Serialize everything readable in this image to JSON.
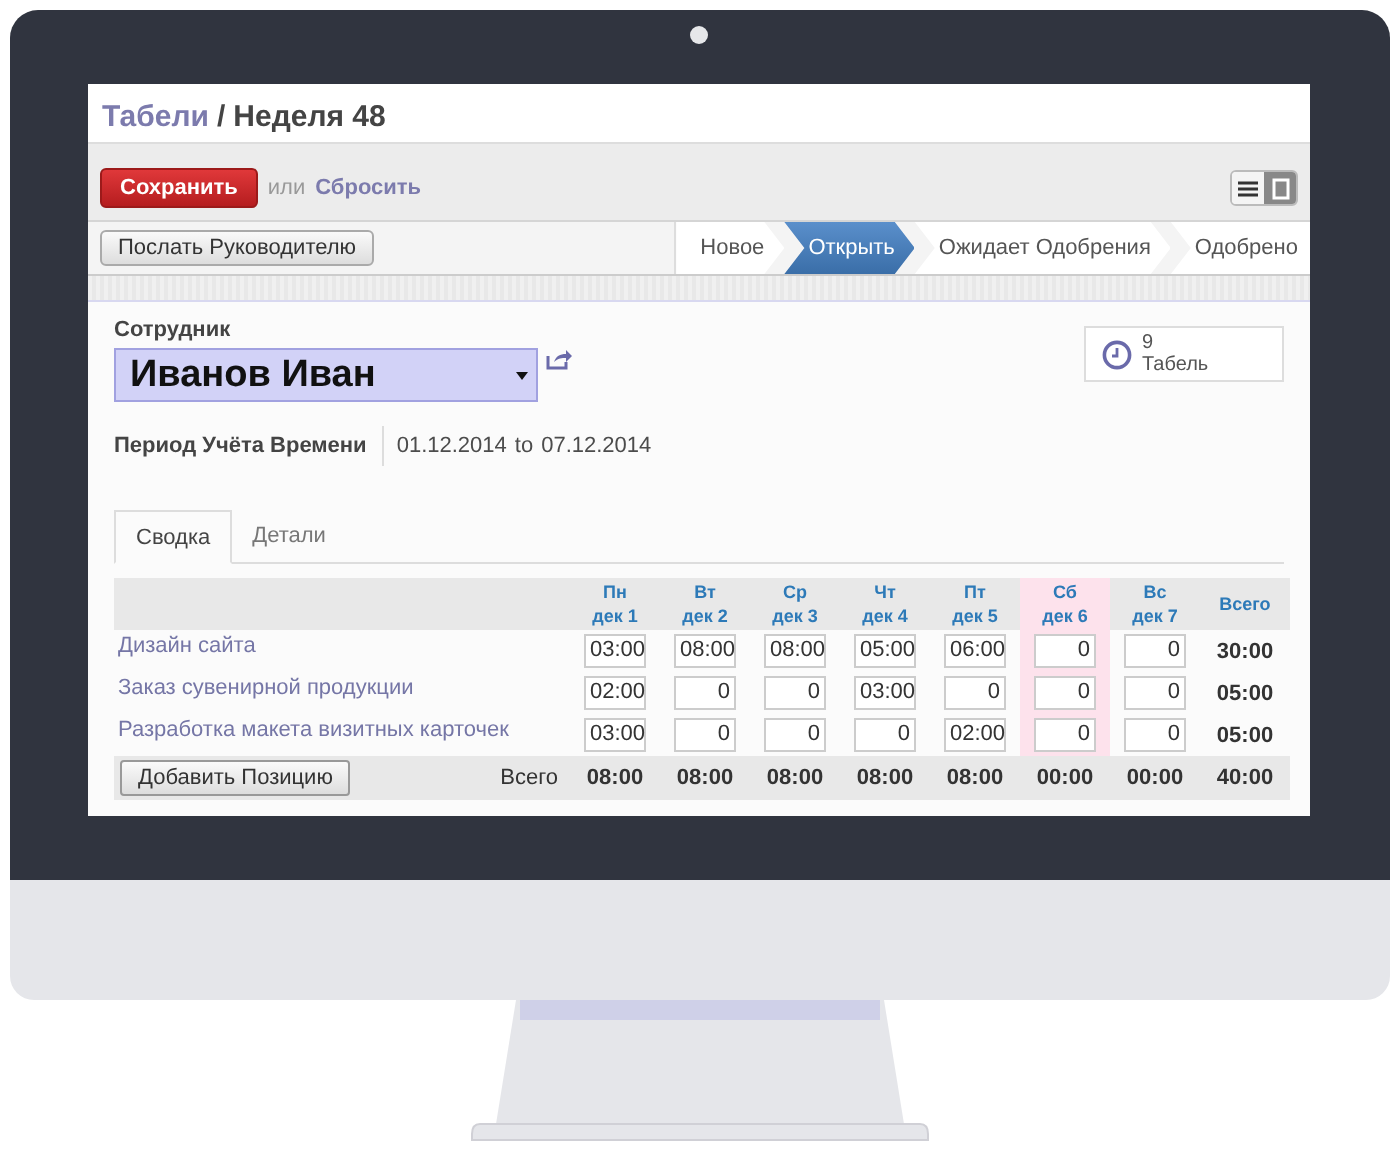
{
  "breadcrumb": {
    "parent": "Табели",
    "separator": "/",
    "current": "Неделя 48"
  },
  "toolbar": {
    "save_button": "Сохранить",
    "or_text": "или",
    "discard_link": "Сбросить",
    "views": [
      {
        "kind": "list",
        "selected": false
      },
      {
        "kind": "form",
        "selected": true
      }
    ]
  },
  "header": {
    "action_button": "Послать Руководителю",
    "stages": [
      {
        "label": "Новое",
        "selected": false
      },
      {
        "label": "Открыть",
        "selected": true
      },
      {
        "label": "Ожидает Одобрения",
        "selected": false
      },
      {
        "label": "Одобрено",
        "selected": false
      }
    ]
  },
  "form": {
    "employee_label": "Сотрудник",
    "employee": "Иванов Иван",
    "period_label": "Период Учёта Времени",
    "period_from": "01.12.2014",
    "period_to_word": "to",
    "period_to": "07.12.2014",
    "smart_button": {
      "count": "9",
      "label": "Табель"
    }
  },
  "tabs": [
    {
      "label": "Сводка",
      "selected": true
    },
    {
      "label": "Детали",
      "selected": false
    }
  ],
  "table": {
    "days": [
      {
        "day": "Пн",
        "date": "дек 1",
        "highlighted": false
      },
      {
        "day": "Вт",
        "date": "дек 2",
        "highlighted": false
      },
      {
        "day": "Ср",
        "date": "дек 3",
        "highlighted": false
      },
      {
        "day": "Чт",
        "date": "дек 4",
        "highlighted": false
      },
      {
        "day": "Пт",
        "date": "дек 5",
        "highlighted": false
      },
      {
        "day": "Сб",
        "date": "дек 6",
        "highlighted": true
      },
      {
        "day": "Вс",
        "date": "дек 7",
        "highlighted": false
      }
    ],
    "total_heading": "Всего",
    "rows": [
      {
        "name": "Дизайн сайта",
        "hours": [
          "03:00",
          "08:00",
          "08:00",
          "05:00",
          "06:00",
          "0",
          "0"
        ],
        "total": "30:00"
      },
      {
        "name": "Заказ сувенирной продукции",
        "hours": [
          "02:00",
          "0",
          "0",
          "03:00",
          "0",
          "0",
          "0"
        ],
        "total": "05:00"
      },
      {
        "name": "Разработка макета визитных карточек",
        "hours": [
          "03:00",
          "0",
          "0",
          "0",
          "02:00",
          "0",
          "0"
        ],
        "total": "05:00"
      }
    ],
    "add_button": "Добавить Позицию",
    "footer_label": "Всего",
    "day_totals": [
      "08:00",
      "08:00",
      "08:00",
      "08:00",
      "08:00",
      "00:00",
      "00:00"
    ],
    "grand_total": "40:00"
  }
}
